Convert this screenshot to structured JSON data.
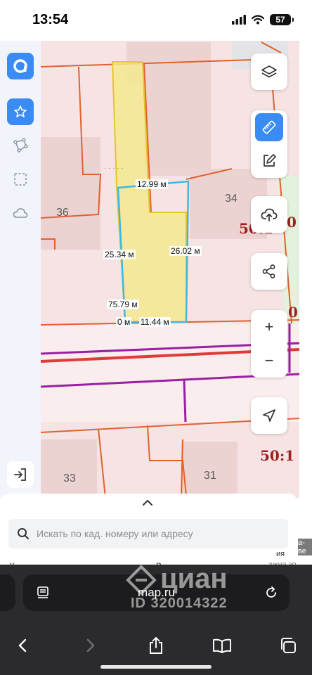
{
  "status_bar": {
    "time": "13:54",
    "battery": "57"
  },
  "sidebar": {
    "items": [
      {
        "name": "logo-icon"
      },
      {
        "name": "star-icon",
        "active": true
      },
      {
        "name": "polygon-tool-icon"
      },
      {
        "name": "selection-icon"
      },
      {
        "name": "cloud-icon"
      },
      {
        "name": "logout-icon"
      }
    ]
  },
  "map": {
    "measurements": {
      "top": "12.99 м",
      "left": "25.34 м",
      "right": "26.02 м",
      "area": "75.79 м",
      "bottom_zero": "0 м",
      "bottom": "11.44 м"
    },
    "parcel_numbers": {
      "n36": "36",
      "n34": "34",
      "n33": "33",
      "n31": "31"
    },
    "cadastral_labels": {
      "right_top": "50:1",
      "right_top_tail": "0",
      "right_mid": "0:",
      "bottom_right": "50:1"
    },
    "dots": "· · · · ·",
    "colors": {
      "parcel_fill": "#f5e88f",
      "selection_outline": "#3fb8e6",
      "border_line": "#e0622e",
      "road_line": "#9b1fa3",
      "road_red": "#e03a3a"
    }
  },
  "controls": {
    "layers": "layers-icon",
    "ruler": "ruler-icon",
    "edit": "edit-icon",
    "upload": "cloud-upload-icon",
    "share": "share-icon",
    "zoom_in": "+",
    "zoom_out": "−",
    "locate": "navigation-arrow-icon"
  },
  "bottom_panel": {
    "search_placeholder": "Искать по кад. номеру или адресу",
    "peek_left": "К",
    "peek_mid": "В",
    "peek_right1": "а-ве",
    "peek_right2": "ия",
    "peek_right3": "ажна зо"
  },
  "browser": {
    "url": "map.ru",
    "watermark": "циан",
    "watermark_id": "ID 320014322"
  }
}
